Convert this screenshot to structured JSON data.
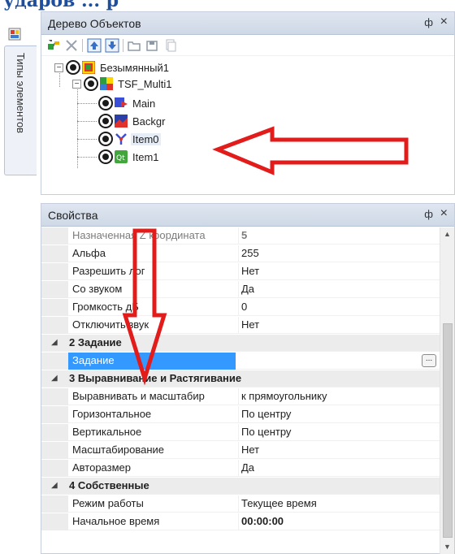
{
  "top_cut_text": "ударов ... р",
  "left_tab": {
    "label": "Типы элементов"
  },
  "tree_panel": {
    "title": "Дерево Объектов",
    "pin": "ф",
    "close": "×",
    "toolbar": [
      "add-object-icon",
      "delete-icon",
      "move-up-icon",
      "move-down-icon",
      "open-folder-icon",
      "save-icon",
      "copy-icon"
    ],
    "nodes": [
      {
        "label": "Безымянный1",
        "icon": "project-icon",
        "expander": "−"
      },
      {
        "label": "TSF_Multi1",
        "icon": "multi-icon",
        "expander": "−"
      },
      {
        "label": "Main",
        "icon": "main-scene-icon"
      },
      {
        "label": "Backgr",
        "icon": "background-icon"
      },
      {
        "label": "Item0",
        "icon": "item-icon"
      },
      {
        "label": "Item1",
        "icon": "qt-icon"
      }
    ]
  },
  "props_panel": {
    "title": "Свойства",
    "pin": "ф",
    "close": "×",
    "rows": [
      {
        "name": "Назначенная Z координата",
        "value": "5",
        "kind": "muted"
      },
      {
        "name": "Альфа",
        "value": "255"
      },
      {
        "name": "Разрешить лог",
        "value": "Нет"
      },
      {
        "name": "Со звуком",
        "value": "Да"
      },
      {
        "name": "Громкость дБ",
        "value": "0"
      },
      {
        "name": "Отключить звук",
        "value": "Нет"
      },
      {
        "name": "2 Задание",
        "value": "",
        "kind": "category"
      },
      {
        "name": "Задание",
        "value": "",
        "kind": "selected"
      },
      {
        "name": "3 Выравнивание и Растягивание",
        "value": "",
        "kind": "category"
      },
      {
        "name": "Выравнивать и масштабир",
        "value": "к прямоугольнику"
      },
      {
        "name": "Горизонтальное",
        "value": "По центру"
      },
      {
        "name": "Вертикальное",
        "value": "По центру"
      },
      {
        "name": "Масштабирование",
        "value": "Нет"
      },
      {
        "name": "Авторазмер",
        "value": "Да"
      },
      {
        "name": "4 Собственные",
        "value": "",
        "kind": "category"
      },
      {
        "name": "Режим работы",
        "value": "Текущее время"
      },
      {
        "name": "Начальное время",
        "value": "00:00:00",
        "kind": "bold"
      }
    ],
    "ellipsis": "..."
  },
  "colors": {
    "annotation": "#e21b1b",
    "selection": "#3399ff"
  }
}
